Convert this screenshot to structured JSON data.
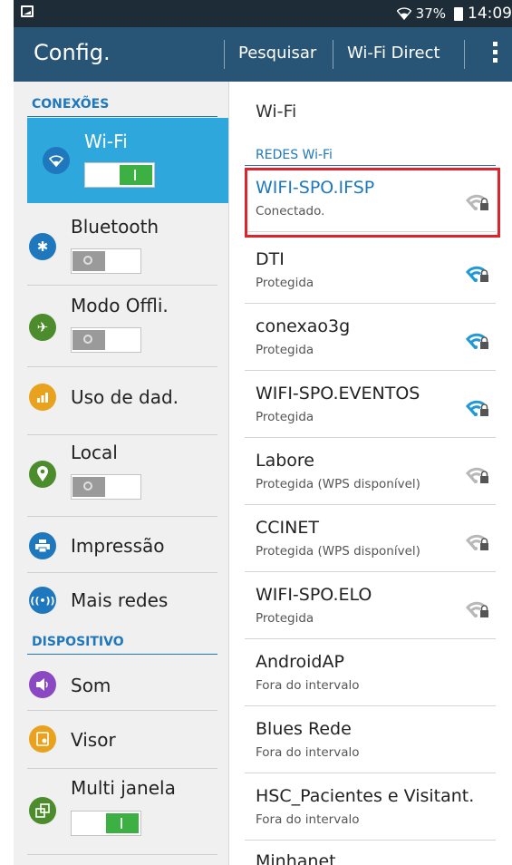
{
  "status_bar": {
    "battery": "37%",
    "time": "14:09"
  },
  "action_bar": {
    "title": "Config.",
    "search": "Pesquisar",
    "wifi_direct": "Wi-Fi Direct"
  },
  "sidebar": {
    "section_connections": "CONEXÕES",
    "section_device": "DISPOSITIVO",
    "items": [
      {
        "label": "Wi-Fi",
        "color": "#2ea8dc",
        "icon": "wifi-icon",
        "toggle": "on"
      },
      {
        "label": "Bluetooth",
        "color": "#1f78bd",
        "icon": "bluetooth-icon",
        "toggle": "off"
      },
      {
        "label": "Modo Offli.",
        "color": "#4c8c2c",
        "icon": "airplane-icon",
        "toggle": "off"
      },
      {
        "label": "Uso de dad.",
        "color": "#e8a21d",
        "icon": "data-usage-icon"
      },
      {
        "label": "Local",
        "color": "#4c8c2c",
        "icon": "location-icon",
        "toggle": "off"
      },
      {
        "label": "Impressão",
        "color": "#1f78bd",
        "icon": "print-icon"
      },
      {
        "label": "Mais redes",
        "color": "#1f78bd",
        "icon": "more-networks-icon"
      },
      {
        "label": "Som",
        "color": "#8a48c2",
        "icon": "sound-icon"
      },
      {
        "label": "Visor",
        "color": "#e8a21d",
        "icon": "display-icon"
      },
      {
        "label": "Multi janela",
        "color": "#4c8c2c",
        "icon": "multi-window-icon",
        "toggle": "on"
      }
    ]
  },
  "wifi_panel": {
    "header": "Wi-Fi",
    "section": "REDES Wi-Fi",
    "networks": [
      {
        "name": "WIFI-SPO.IFSP",
        "status": "Conectado.",
        "signal": "gray"
      },
      {
        "name": "DTI",
        "status": "Protegida",
        "signal": "blue"
      },
      {
        "name": "conexao3g",
        "status": "Protegida",
        "signal": "blue"
      },
      {
        "name": "WIFI-SPO.EVENTOS",
        "status": "Protegida",
        "signal": "blue"
      },
      {
        "name": "Labore",
        "status": "Protegida (WPS disponível)",
        "signal": "gray"
      },
      {
        "name": "CCINET",
        "status": "Protegida (WPS disponível)",
        "signal": "gray"
      },
      {
        "name": "WIFI-SPO.ELO",
        "status": "Protegida",
        "signal": "gray"
      },
      {
        "name": "AndroidAP",
        "status": "Fora do intervalo"
      },
      {
        "name": "Blues Rede",
        "status": "Fora do intervalo"
      },
      {
        "name": "HSC_Pacientes e Visitant.",
        "status": "Fora do intervalo"
      },
      {
        "name": "Minhanet",
        "status": ""
      }
    ]
  },
  "colors": {
    "action_bar": "#285475",
    "accent": "#1f78bd",
    "selected": "#2ea8dc",
    "toggle_on": "#3cb043",
    "highlight": "#e0232b"
  }
}
